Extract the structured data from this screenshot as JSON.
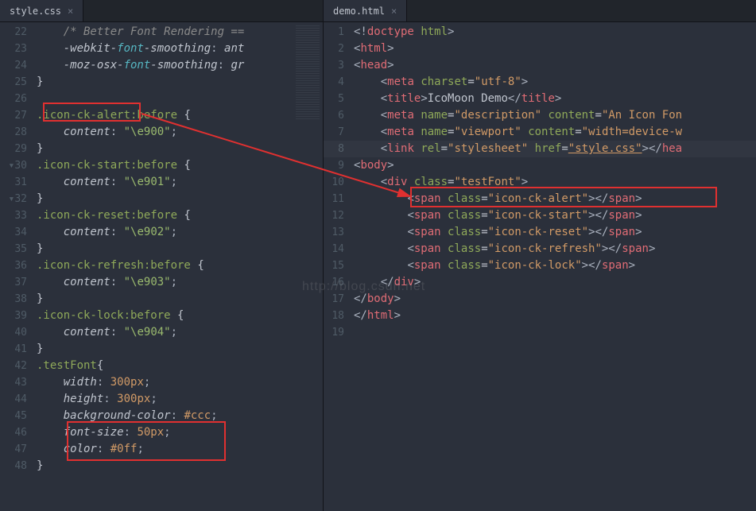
{
  "left": {
    "tab": "style.css",
    "lines": [
      {
        "n": 22,
        "html": "    <span class='tok-comment'>/* Better Font Rendering ==</span>"
      },
      {
        "n": 23,
        "html": "    <span class='tok-propkey'>-webkit-</span><span class='tok-font'>font</span><span class='tok-propkey'>-smoothing</span><span class='tok-punct'>:</span> <span class='tok-prop'>ant</span>"
      },
      {
        "n": 24,
        "html": "    <span class='tok-propkey'>-moz-osx-</span><span class='tok-font'>font</span><span class='tok-propkey'>-smoothing</span><span class='tok-punct'>:</span> <span class='tok-prop'>gr</span>"
      },
      {
        "n": 25,
        "html": "<span class='tok-brace'>}</span>"
      },
      {
        "n": 26,
        "html": ""
      },
      {
        "n": 27,
        "html": "<span class='tok-sel'>.icon-ck-alert:before</span> <span class='tok-brace'>{</span>"
      },
      {
        "n": 28,
        "html": "    <span class='tok-propkey'>content</span><span class='tok-punct'>:</span> <span class='tok-str'>\"\\e900\"</span><span class='tok-punct'>;</span>"
      },
      {
        "n": 29,
        "html": "<span class='tok-brace'>}</span>"
      },
      {
        "n": 30,
        "html": "<span class='tok-sel'>.icon-ck-start:before</span> <span class='tok-brace'>{</span>"
      },
      {
        "n": 31,
        "html": "    <span class='tok-propkey'>content</span><span class='tok-punct'>:</span> <span class='tok-str'>\"\\e901\"</span><span class='tok-punct'>;</span>"
      },
      {
        "n": 32,
        "html": "<span class='tok-brace'>}</span>"
      },
      {
        "n": 33,
        "html": "<span class='tok-sel'>.icon-ck-reset:before</span> <span class='tok-brace'>{</span>"
      },
      {
        "n": 34,
        "html": "    <span class='tok-propkey'>content</span><span class='tok-punct'>:</span> <span class='tok-str'>\"\\e902\"</span><span class='tok-punct'>;</span>"
      },
      {
        "n": 35,
        "html": "<span class='tok-brace'>}</span>"
      },
      {
        "n": 36,
        "html": "<span class='tok-sel'>.icon-ck-refresh:before</span> <span class='tok-brace'>{</span>"
      },
      {
        "n": 37,
        "html": "    <span class='tok-propkey'>content</span><span class='tok-punct'>:</span> <span class='tok-str'>\"\\e903\"</span><span class='tok-punct'>;</span>"
      },
      {
        "n": 38,
        "html": "<span class='tok-brace'>}</span>"
      },
      {
        "n": 39,
        "html": "<span class='tok-sel'>.icon-ck-lock:before</span> <span class='tok-brace'>{</span>"
      },
      {
        "n": 40,
        "html": "    <span class='tok-propkey'>content</span><span class='tok-punct'>:</span> <span class='tok-str'>\"\\e904\"</span><span class='tok-punct'>;</span>"
      },
      {
        "n": 41,
        "html": "<span class='tok-brace'>}</span>"
      },
      {
        "n": 42,
        "html": "<span class='tok-sel'>.testFont</span><span class='tok-brace'>{</span>"
      },
      {
        "n": 43,
        "html": "    <span class='tok-propkey'>width</span><span class='tok-punct'>:</span> <span class='tok-val'>300px</span><span class='tok-punct'>;</span>"
      },
      {
        "n": 44,
        "html": "    <span class='tok-propkey'>height</span><span class='tok-punct'>:</span> <span class='tok-val'>300px</span><span class='tok-punct'>;</span>"
      },
      {
        "n": 45,
        "html": "    <span class='tok-propkey'>background-color</span><span class='tok-punct'>:</span> <span class='tok-valhex'>#ccc</span><span class='tok-punct'>;</span>"
      },
      {
        "n": 46,
        "html": "    <span class='tok-propkey'>font-size</span><span class='tok-punct'>:</span> <span class='tok-val'>50px</span><span class='tok-punct'>;</span>"
      },
      {
        "n": 47,
        "html": "    <span class='tok-propkey'>color</span><span class='tok-punct'>:</span> <span class='tok-valhex'>#0ff</span><span class='tok-punct'>;</span>"
      },
      {
        "n": 48,
        "html": "<span class='tok-brace'>}</span>"
      }
    ]
  },
  "right": {
    "tab": "demo.html",
    "lines": [
      {
        "n": 1,
        "html": "<span class='tok-tagbr'>&lt;!</span><span class='tok-tag'>doctype</span> <span class='tok-attr'>html</span><span class='tok-tagbr'>&gt;</span>"
      },
      {
        "n": 2,
        "html": "<span class='tok-tagbr'>&lt;</span><span class='tok-tag'>html</span><span class='tok-tagbr'>&gt;</span>"
      },
      {
        "n": 3,
        "html": "<span class='tok-tagbr'>&lt;</span><span class='tok-tag'>head</span><span class='tok-tagbr'>&gt;</span>"
      },
      {
        "n": 4,
        "html": "    <span class='tok-tagbr'>&lt;</span><span class='tok-tag'>meta</span> <span class='tok-attr'>charset</span>=<span class='tok-attrval'>\"utf-8\"</span><span class='tok-tagbr'>&gt;</span>"
      },
      {
        "n": 5,
        "html": "    <span class='tok-tagbr'>&lt;</span><span class='tok-tag'>title</span><span class='tok-tagbr'>&gt;</span><span class='tok-text'>IcoMoon Demo</span><span class='tok-tagbr'>&lt;/</span><span class='tok-tag'>title</span><span class='tok-tagbr'>&gt;</span>"
      },
      {
        "n": 6,
        "html": "    <span class='tok-tagbr'>&lt;</span><span class='tok-tag'>meta</span> <span class='tok-attr'>name</span>=<span class='tok-attrval'>\"description\"</span> <span class='tok-attr'>content</span>=<span class='tok-attrval'>\"An Icon Fon</span>"
      },
      {
        "n": 7,
        "html": "    <span class='tok-tagbr'>&lt;</span><span class='tok-tag'>meta</span> <span class='tok-attr'>name</span>=<span class='tok-attrval'>\"viewport\"</span> <span class='tok-attr'>content</span>=<span class='tok-attrval'>\"width=device-w</span>"
      },
      {
        "n": 8,
        "html": "    <span class='tok-tagbr'>&lt;</span><span class='tok-tag'>link</span> <span class='tok-attr'>rel</span>=<span class='tok-attrval'>\"stylesheet\"</span> <span class='tok-attr'>href</span>=<span class='tok-attrval'><u>\"style.css\"</u></span><span class='tok-tagbr'>&gt;&lt;/</span><span class='tok-tag'>hea</span>"
      },
      {
        "n": 9,
        "html": "<span class='tok-tagbr'>&lt;</span><span class='tok-tag'>body</span><span class='tok-tagbr'>&gt;</span>"
      },
      {
        "n": 10,
        "html": "    <span class='tok-tagbr'>&lt;</span><span class='tok-tag'>div</span> <span class='tok-attr'>class</span>=<span class='tok-attrval'>\"testFont\"</span><span class='tok-tagbr'>&gt;</span>"
      },
      {
        "n": 11,
        "html": "        <span class='tok-tagbr'>&lt;</span><span class='tok-tag'>span</span> <span class='tok-attr'>class</span>=<span class='tok-attrval'>\"icon-ck-alert\"</span><span class='tok-tagbr'>&gt;&lt;/</span><span class='tok-tag'>span</span><span class='tok-tagbr'>&gt;</span>"
      },
      {
        "n": 12,
        "html": "        <span class='tok-tagbr'>&lt;</span><span class='tok-tag'>span</span> <span class='tok-attr'>class</span>=<span class='tok-attrval'>\"icon-ck-start\"</span><span class='tok-tagbr'>&gt;&lt;/</span><span class='tok-tag'>span</span><span class='tok-tagbr'>&gt;</span>"
      },
      {
        "n": 13,
        "html": "        <span class='tok-tagbr'>&lt;</span><span class='tok-tag'>span</span> <span class='tok-attr'>class</span>=<span class='tok-attrval'>\"icon-ck-reset\"</span><span class='tok-tagbr'>&gt;&lt;/</span><span class='tok-tag'>span</span><span class='tok-tagbr'>&gt;</span>"
      },
      {
        "n": 14,
        "html": "        <span class='tok-tagbr'>&lt;</span><span class='tok-tag'>span</span> <span class='tok-attr'>class</span>=<span class='tok-attrval'>\"icon-ck-refresh\"</span><span class='tok-tagbr'>&gt;&lt;/</span><span class='tok-tag'>span</span><span class='tok-tagbr'>&gt;</span>"
      },
      {
        "n": 15,
        "html": "        <span class='tok-tagbr'>&lt;</span><span class='tok-tag'>span</span> <span class='tok-attr'>class</span>=<span class='tok-attrval'>\"icon-ck-lock\"</span><span class='tok-tagbr'>&gt;&lt;/</span><span class='tok-tag'>span</span><span class='tok-tagbr'>&gt;</span>"
      },
      {
        "n": 16,
        "html": "    <span class='tok-tagbr'>&lt;/</span><span class='tok-tag'>div</span><span class='tok-tagbr'>&gt;</span>"
      },
      {
        "n": 17,
        "html": "<span class='tok-tagbr'>&lt;/</span><span class='tok-tag'>body</span><span class='tok-tagbr'>&gt;</span>"
      },
      {
        "n": 18,
        "html": "<span class='tok-tagbr'>&lt;/</span><span class='tok-tag'>html</span><span class='tok-tagbr'>&gt;</span>"
      },
      {
        "n": 19,
        "html": ""
      }
    ]
  },
  "watermark": "http://blog.csdn.net"
}
